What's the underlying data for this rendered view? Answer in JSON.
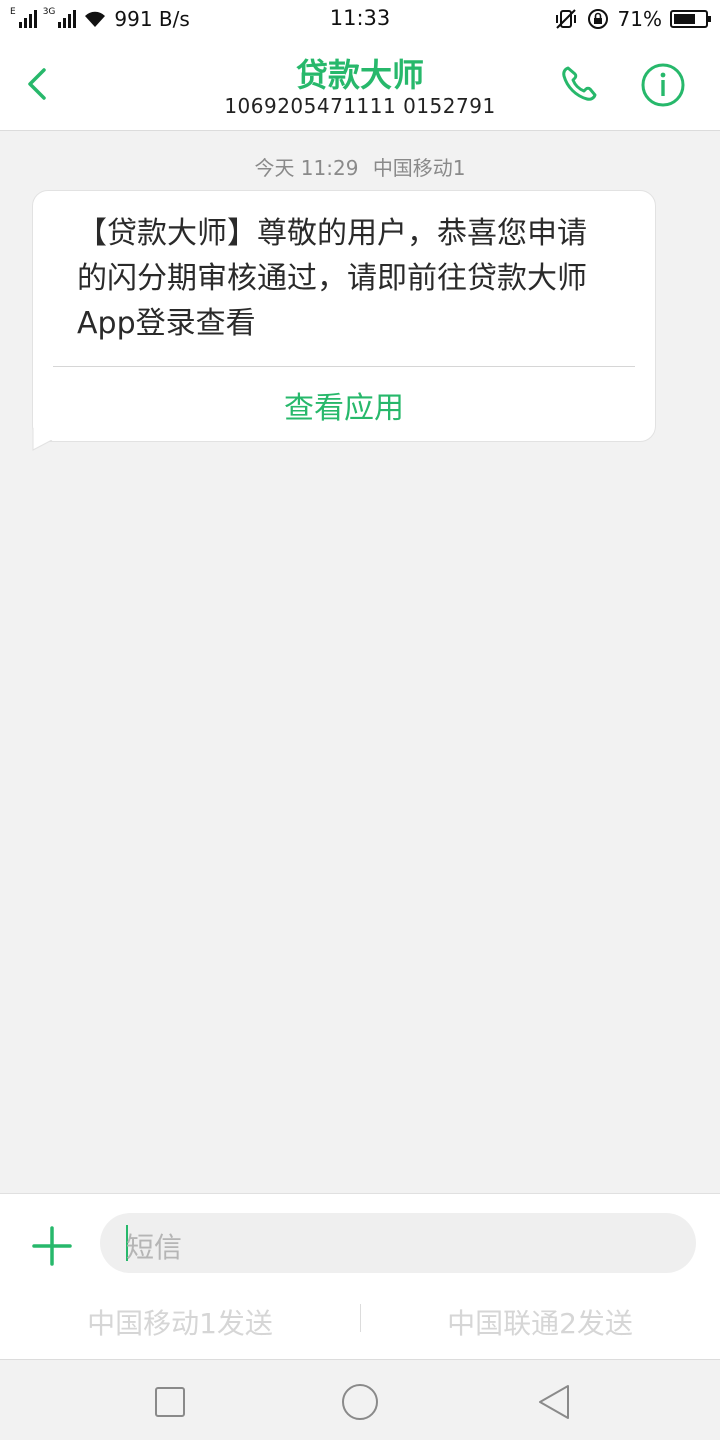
{
  "status_bar": {
    "network_tag_1": "E",
    "network_tag_2": "3G",
    "speed": "991 B/s",
    "time": "11:33",
    "battery": "71%",
    "battery_level": 0.71
  },
  "header": {
    "title": "贷款大师",
    "number": "1069205471111 0152791"
  },
  "conversation": {
    "date_label": "今天 11:29",
    "sim_label": "中国移动1",
    "message": {
      "line1": "【贷款大师】尊敬的用户，恭喜您申请",
      "line2": "的闪分期审核通过，请即前往贷款大师",
      "line3": "App登录查看",
      "action": "查看应用"
    }
  },
  "composer": {
    "placeholder": "短信",
    "send_sim1": "中国移动1发送",
    "send_sim2": "中国联通2发送"
  },
  "colors": {
    "accent": "#27b86b",
    "background": "#f2f2f2"
  },
  "icons": {
    "back": "chevron-left-icon",
    "call": "phone-icon",
    "info": "info-icon",
    "add": "plus-icon",
    "nav_recents": "square-icon",
    "nav_home": "circle-icon",
    "nav_back": "triangle-icon"
  }
}
